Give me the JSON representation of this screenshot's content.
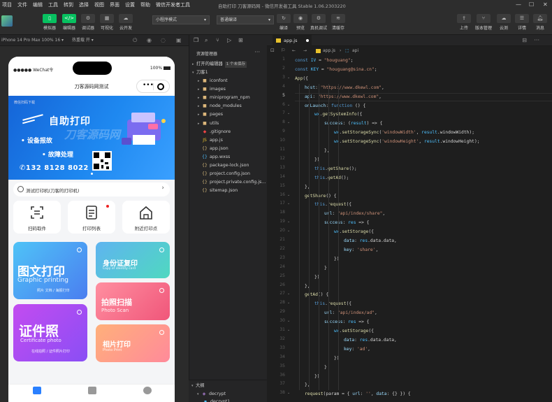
{
  "menubar": {
    "items": [
      "项目",
      "文件",
      "编辑",
      "工具",
      "转到",
      "选择",
      "视图",
      "界面",
      "设置",
      "帮助",
      "微信开发者工具"
    ],
    "window_title": "自助打印 刀客源码网 - 微信开发者工具 Stable 1.06.2303220"
  },
  "toolbar": {
    "left_buttons": [
      "模拟器",
      "编辑器",
      "调试器",
      "可视化",
      "云开发"
    ],
    "mode_select": "小程序模式",
    "compile_select": "普通编译",
    "center_buttons": [
      "编译",
      "预览",
      "真机调试",
      "清缓存"
    ],
    "right_buttons": [
      "上传",
      "版本管理",
      "云测",
      "详情",
      "消息"
    ]
  },
  "simulator": {
    "device": "iPhone 14 Pro Max 100% 16 ▾",
    "hot_reload": "热重载 开 ▾",
    "status_left": "●●●●● WeChat令",
    "status_right": "100%",
    "nav_title": "刀客源码网测试",
    "banner": {
      "top_text": "微信扫码下载",
      "title": "自助打印",
      "line1": "• 设备报故",
      "line2": "• 故障处理",
      "phone": "132 8128 8022"
    },
    "notice": "测试打印机(刀客的打印机)",
    "quick_buttons": [
      "扫码取件",
      "打印列表",
      "附近打印点"
    ],
    "cards": {
      "graphic_title": "图文打印",
      "graphic_en": "Graphic printing",
      "graphic_sub": "照片 文档 / 海报打印",
      "id_title": "身份证复印",
      "id_en": "Copy of identity card",
      "cert_title": "证件照",
      "cert_en": "Certificate photo",
      "cert_sub": "在线拍照 / 证件照片打印",
      "scan_title": "拍照扫描",
      "scan_en": "Photo Scan",
      "album_title": "相片打印",
      "album_en": "Photo Print"
    },
    "watermark": "刀客源码网"
  },
  "explorer": {
    "header": "资源管理器",
    "open_editors": "打开的编辑器",
    "unsaved_badge": "1 个未保存",
    "project": "刀客1",
    "tree": [
      {
        "name": "iconfont",
        "kind": "folder"
      },
      {
        "name": "images",
        "kind": "folder"
      },
      {
        "name": "miniprogram_npm",
        "kind": "folder"
      },
      {
        "name": "node_modules",
        "kind": "folder"
      },
      {
        "name": "pages",
        "kind": "folder"
      },
      {
        "name": "utils",
        "kind": "folder"
      },
      {
        "name": ".gitignore",
        "kind": "git"
      },
      {
        "name": "app.js",
        "kind": "js"
      },
      {
        "name": "app.json",
        "kind": "json"
      },
      {
        "name": "app.wxss",
        "kind": "wxss"
      },
      {
        "name": "package-lock.json",
        "kind": "json"
      },
      {
        "name": "project.config.json",
        "kind": "json"
      },
      {
        "name": "project.private.config.js...",
        "kind": "json"
      },
      {
        "name": "sitemap.json",
        "kind": "json"
      }
    ],
    "outline": "大纲",
    "outline_item": "decrypt",
    "outline_sub": "decrypt1"
  },
  "editor": {
    "tab": "app.js",
    "breadcrumb_file": "app.js",
    "breadcrumb_symbol": "api",
    "current_line": 5,
    "lines": [
      {
        "n": 1,
        "indent": 0,
        "text": "const IV = \"houguang\";"
      },
      {
        "n": 2,
        "indent": 0,
        "text": "const KEY = \"houguang@sina.cn\";"
      },
      {
        "n": 3,
        "indent": 0,
        "text": "App({"
      },
      {
        "n": 4,
        "indent": 1,
        "text": "host: \"https://www.dkewl.com\","
      },
      {
        "n": 5,
        "indent": 1,
        "text": "api: \"https://www.dkewl.com\","
      },
      {
        "n": 6,
        "indent": 1,
        "text": "onLaunch: function () {"
      },
      {
        "n": 7,
        "indent": 2,
        "text": "wx.getSystemInfo({"
      },
      {
        "n": 8,
        "indent": 3,
        "text": "success: (result) => {"
      },
      {
        "n": 9,
        "indent": 4,
        "text": "wx.setStorageSync('windowWidth', result.windowWidth);"
      },
      {
        "n": 10,
        "indent": 4,
        "text": "wx.setStorageSync('windowHeight', result.windowHeight);"
      },
      {
        "n": 11,
        "indent": 3,
        "text": "},"
      },
      {
        "n": 12,
        "indent": 2,
        "text": "})"
      },
      {
        "n": 13,
        "indent": 2,
        "text": "this.getShare();"
      },
      {
        "n": 14,
        "indent": 2,
        "text": "this.getAd();"
      },
      {
        "n": 15,
        "indent": 1,
        "text": "},"
      },
      {
        "n": 16,
        "indent": 1,
        "text": "getShare() {"
      },
      {
        "n": 17,
        "indent": 2,
        "text": "this.request({"
      },
      {
        "n": 18,
        "indent": 3,
        "text": "url: \"api/index/share\","
      },
      {
        "n": 19,
        "indent": 3,
        "text": "success: res => {"
      },
      {
        "n": 20,
        "indent": 4,
        "text": "wx.setStorage({"
      },
      {
        "n": 21,
        "indent": 5,
        "text": "data: res.data.data,"
      },
      {
        "n": 22,
        "indent": 5,
        "text": "key: 'share',"
      },
      {
        "n": 23,
        "indent": 4,
        "text": "})"
      },
      {
        "n": 24,
        "indent": 3,
        "text": "}"
      },
      {
        "n": 25,
        "indent": 2,
        "text": "})"
      },
      {
        "n": 26,
        "indent": 1,
        "text": "},"
      },
      {
        "n": 27,
        "indent": 1,
        "text": "getAd() {"
      },
      {
        "n": 28,
        "indent": 2,
        "text": "this.request({"
      },
      {
        "n": 29,
        "indent": 3,
        "text": "url: \"api/index/ad\","
      },
      {
        "n": 30,
        "indent": 3,
        "text": "success: res => {"
      },
      {
        "n": 31,
        "indent": 4,
        "text": "wx.setStorage({"
      },
      {
        "n": 32,
        "indent": 5,
        "text": "data: res.data.data,"
      },
      {
        "n": 33,
        "indent": 5,
        "text": "key: 'ad',"
      },
      {
        "n": 34,
        "indent": 4,
        "text": "})"
      },
      {
        "n": 35,
        "indent": 3,
        "text": "}"
      },
      {
        "n": 36,
        "indent": 2,
        "text": "})"
      },
      {
        "n": 37,
        "indent": 1,
        "text": "},"
      },
      {
        "n": 38,
        "indent": 1,
        "text": "request(param = { url: '', data: {} }) {"
      }
    ]
  },
  "colors": {
    "accent_green": "#07c160",
    "banner_blue": "#1e88f0",
    "editor_bg": "#1e1e1e"
  }
}
